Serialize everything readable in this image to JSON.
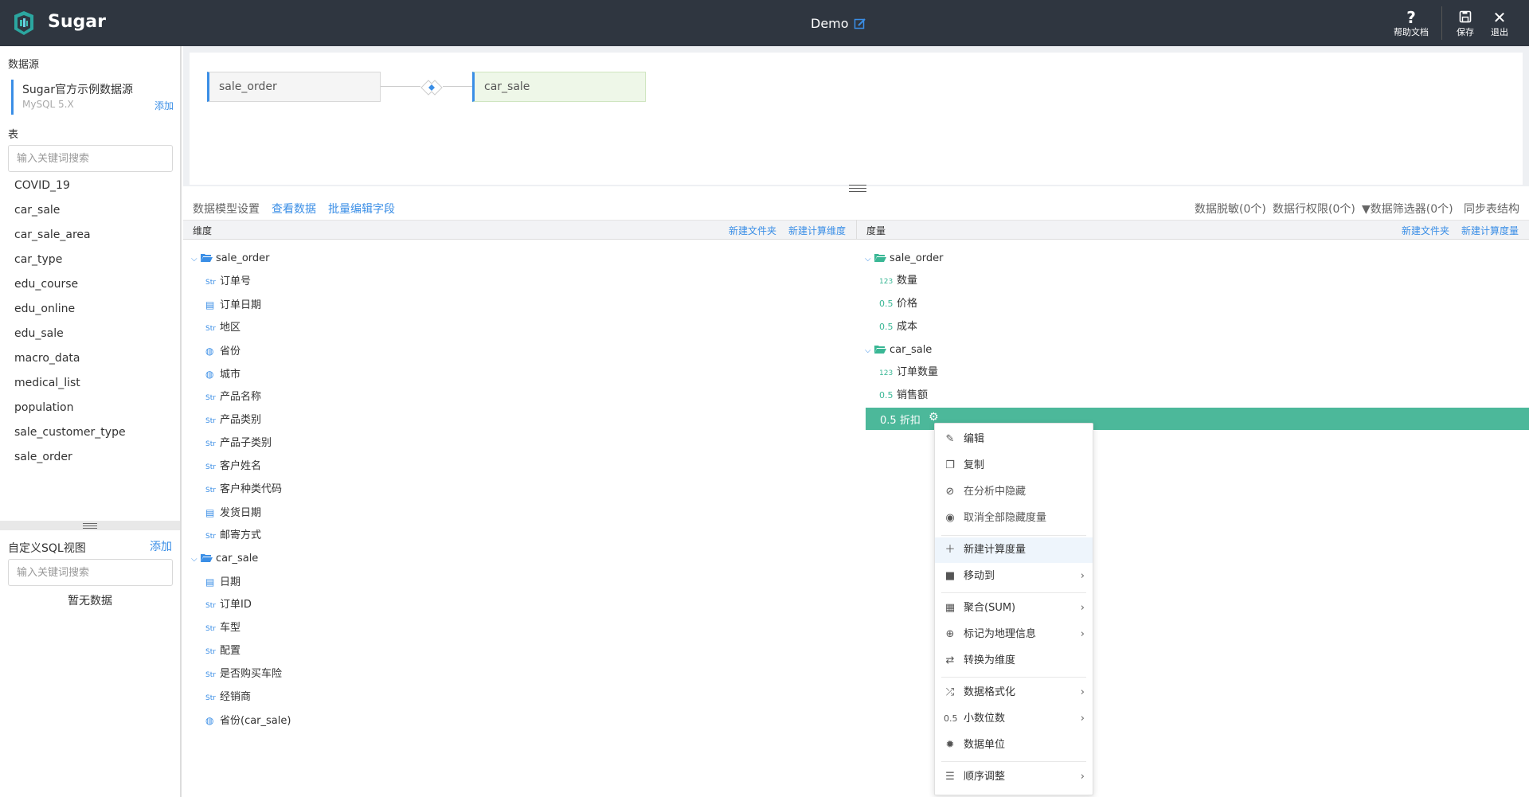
{
  "header": {
    "brand": "Sugar",
    "title": "Demo",
    "help_label": "帮助文档",
    "save_label": "保存",
    "exit_label": "退出"
  },
  "left": {
    "datasource_title": "数据源",
    "datasource_name": "Sugar官方示例数据源",
    "datasource_type": "MySQL 5.X",
    "datasource_add": "添加",
    "tables_title": "表",
    "table_search_placeholder": "输入关键词搜索",
    "tables": [
      "COVID_19",
      "car_sale",
      "car_sale_area",
      "car_type",
      "edu_course",
      "edu_online",
      "edu_sale",
      "macro_data",
      "medical_list",
      "population",
      "sale_customer_type",
      "sale_order"
    ],
    "sql_title": "自定义SQL视图",
    "sql_add": "添加",
    "sql_search_placeholder": "输入关键词搜索",
    "sql_empty": "暂无数据"
  },
  "canvas": {
    "left_table": "sale_order",
    "right_table": "car_sale"
  },
  "toolbar": {
    "model_settings": "数据模型设置",
    "view_data": "查看数据",
    "batch_edit": "批量编辑字段",
    "masking": "数据脱敏(0个)",
    "row_permission": "数据行权限(0个)",
    "filters": "数据筛选器(0个)",
    "sync": "同步表结构"
  },
  "dimensions": {
    "title": "维度",
    "new_folder": "新建文件夹",
    "new_calc": "新建计算维度",
    "groups": [
      {
        "name": "sale_order",
        "fields": [
          {
            "type": "str",
            "label": "订单号"
          },
          {
            "type": "date",
            "label": "订单日期"
          },
          {
            "type": "str",
            "label": "地区"
          },
          {
            "type": "geo",
            "label": "省份"
          },
          {
            "type": "geo",
            "label": "城市"
          },
          {
            "type": "str",
            "label": "产品名称"
          },
          {
            "type": "str",
            "label": "产品类别"
          },
          {
            "type": "str",
            "label": "产品子类别"
          },
          {
            "type": "str",
            "label": "客户姓名"
          },
          {
            "type": "str",
            "label": "客户种类代码"
          },
          {
            "type": "date",
            "label": "发货日期"
          },
          {
            "type": "str",
            "label": "邮寄方式"
          }
        ]
      },
      {
        "name": "car_sale",
        "fields": [
          {
            "type": "date",
            "label": "日期"
          },
          {
            "type": "str",
            "label": "订单ID"
          },
          {
            "type": "str",
            "label": "车型"
          },
          {
            "type": "str",
            "label": "配置"
          },
          {
            "type": "str",
            "label": "是否购买车险"
          },
          {
            "type": "str",
            "label": "经销商"
          },
          {
            "type": "geo",
            "label": "省份(car_sale)"
          }
        ]
      }
    ],
    "str_tag": "Str"
  },
  "measures": {
    "title": "度量",
    "new_folder": "新建文件夹",
    "new_calc": "新建计算度量",
    "group1": "sale_order",
    "m1_tag": "123",
    "m1": "数量",
    "m2_tag": "0.5",
    "m2": "价格",
    "m3_tag": "0.5",
    "m3": "成本",
    "group2": "car_sale",
    "m4_tag": "123",
    "m4": "订单数量",
    "m5_tag": "0.5",
    "m5": "销售额",
    "m6_tag": "0.5",
    "m6": "折扣"
  },
  "context_menu": {
    "edit": "编辑",
    "copy": "复制",
    "hide": "在分析中隐藏",
    "unhide_all": "取消全部隐藏度量",
    "new_calc_measure": "新建计算度量",
    "move_to": "移动到",
    "aggregate": "聚合(SUM)",
    "mark_geo": "标记为地理信息",
    "to_dimension": "转换为维度",
    "format": "数据格式化",
    "decimal_tag": "0.5",
    "decimals": "小数位数",
    "unit": "数据单位",
    "order": "顺序调整"
  },
  "colors": {
    "header_bg": "#2f3640",
    "accent_blue": "#3a8ee6",
    "accent_green": "#4cb89a"
  }
}
